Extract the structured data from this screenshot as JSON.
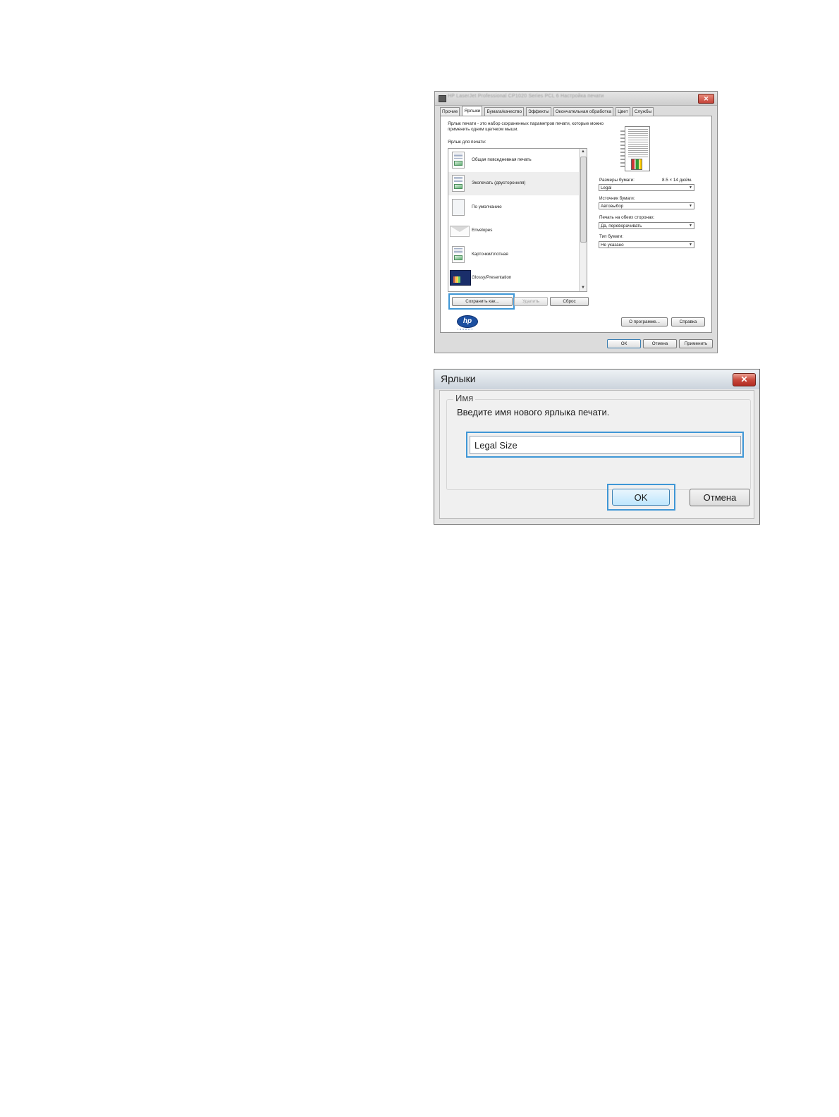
{
  "props_window": {
    "title": "HP LaserJet Professional CP1020 Series PCL 6 Настройка печати",
    "close_glyph": "✕",
    "tabs": [
      "Прочие",
      "Ярлыки",
      "Бумага/качество",
      "Эффекты",
      "Окончательная обработка",
      "Цвет",
      "Службы"
    ],
    "active_tab": "Ярлыки",
    "description": "Ярлык печати - это набор сохраненных параметров печати, которые можно применить одним щелчком мыши.",
    "list_label": "Ярлык для печати:",
    "shortcuts": [
      {
        "label": "Общая повседневная печать",
        "icon": "document-icon"
      },
      {
        "label": "Экопечать (двусторонняя)",
        "icon": "eco-duplex-icon"
      },
      {
        "label": "По умолчанию",
        "icon": "blank-page-icon"
      },
      {
        "label": "Envelopes",
        "icon": "envelope-icon"
      },
      {
        "label": "Карточки/плотная",
        "icon": "cardstock-icon"
      },
      {
        "label": "Glossy/Presentation",
        "icon": "presentation-icon"
      }
    ],
    "selected_shortcut": "Экопечать (двусторонняя)",
    "buttons": {
      "save_as": "Сохранить как...",
      "delete": "Удалить",
      "reset": "Сброс"
    },
    "fields": {
      "paper_size_label": "Размеры бумаги:",
      "paper_size_dims": "8.5 × 14 дюйм.",
      "paper_size": "Legal",
      "paper_source_label": "Источник бумаги:",
      "paper_source": "Автовыбор",
      "duplex_label": "Печать на обеих сторонах:",
      "duplex": "Да, переворачивать",
      "paper_type_label": "Тип бумаги:",
      "paper_type": "Не указано"
    },
    "bottom_buttons": {
      "about": "О программе...",
      "help": "Справка",
      "ok": "ОК",
      "cancel": "Отмена",
      "apply": "Применить"
    },
    "logo": {
      "mark": "hp",
      "tagline": "invent"
    }
  },
  "name_dialog": {
    "title": "Ярлыки",
    "close_glyph": "✕",
    "group_title": "Имя",
    "prompt": "Введите имя нового ярлыка печати.",
    "name_value": "Legal Size",
    "ok_label": "OK",
    "cancel_label": "Отмена"
  },
  "colors": {
    "highlight": "#3f97d6",
    "close_red": "#c9493c"
  }
}
